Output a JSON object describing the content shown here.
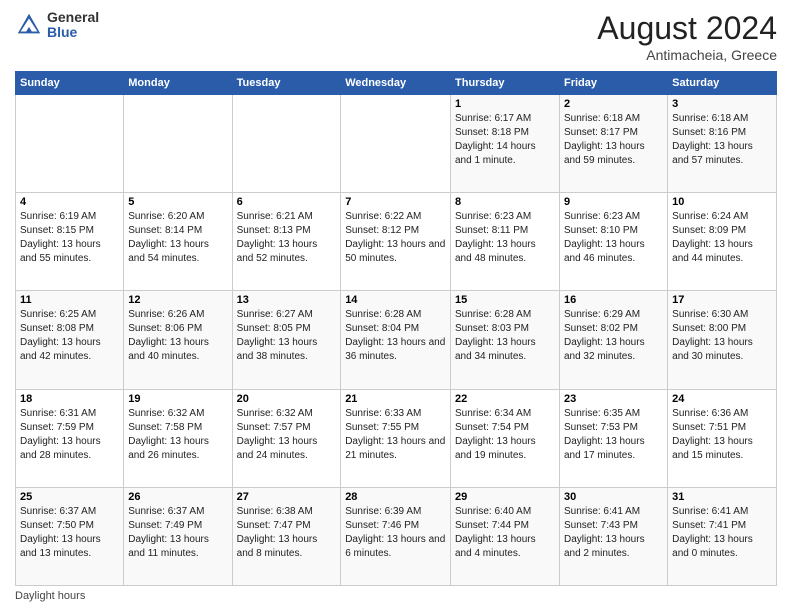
{
  "header": {
    "logo_general": "General",
    "logo_blue": "Blue",
    "month_year": "August 2024",
    "location": "Antimacheia, Greece"
  },
  "calendar": {
    "days_of_week": [
      "Sunday",
      "Monday",
      "Tuesday",
      "Wednesday",
      "Thursday",
      "Friday",
      "Saturday"
    ],
    "weeks": [
      [
        {
          "day": "",
          "info": ""
        },
        {
          "day": "",
          "info": ""
        },
        {
          "day": "",
          "info": ""
        },
        {
          "day": "",
          "info": ""
        },
        {
          "day": "1",
          "info": "Sunrise: 6:17 AM\nSunset: 8:18 PM\nDaylight: 14 hours\nand 1 minute."
        },
        {
          "day": "2",
          "info": "Sunrise: 6:18 AM\nSunset: 8:17 PM\nDaylight: 13 hours\nand 59 minutes."
        },
        {
          "day": "3",
          "info": "Sunrise: 6:18 AM\nSunset: 8:16 PM\nDaylight: 13 hours\nand 57 minutes."
        }
      ],
      [
        {
          "day": "4",
          "info": "Sunrise: 6:19 AM\nSunset: 8:15 PM\nDaylight: 13 hours\nand 55 minutes."
        },
        {
          "day": "5",
          "info": "Sunrise: 6:20 AM\nSunset: 8:14 PM\nDaylight: 13 hours\nand 54 minutes."
        },
        {
          "day": "6",
          "info": "Sunrise: 6:21 AM\nSunset: 8:13 PM\nDaylight: 13 hours\nand 52 minutes."
        },
        {
          "day": "7",
          "info": "Sunrise: 6:22 AM\nSunset: 8:12 PM\nDaylight: 13 hours\nand 50 minutes."
        },
        {
          "day": "8",
          "info": "Sunrise: 6:23 AM\nSunset: 8:11 PM\nDaylight: 13 hours\nand 48 minutes."
        },
        {
          "day": "9",
          "info": "Sunrise: 6:23 AM\nSunset: 8:10 PM\nDaylight: 13 hours\nand 46 minutes."
        },
        {
          "day": "10",
          "info": "Sunrise: 6:24 AM\nSunset: 8:09 PM\nDaylight: 13 hours\nand 44 minutes."
        }
      ],
      [
        {
          "day": "11",
          "info": "Sunrise: 6:25 AM\nSunset: 8:08 PM\nDaylight: 13 hours\nand 42 minutes."
        },
        {
          "day": "12",
          "info": "Sunrise: 6:26 AM\nSunset: 8:06 PM\nDaylight: 13 hours\nand 40 minutes."
        },
        {
          "day": "13",
          "info": "Sunrise: 6:27 AM\nSunset: 8:05 PM\nDaylight: 13 hours\nand 38 minutes."
        },
        {
          "day": "14",
          "info": "Sunrise: 6:28 AM\nSunset: 8:04 PM\nDaylight: 13 hours\nand 36 minutes."
        },
        {
          "day": "15",
          "info": "Sunrise: 6:28 AM\nSunset: 8:03 PM\nDaylight: 13 hours\nand 34 minutes."
        },
        {
          "day": "16",
          "info": "Sunrise: 6:29 AM\nSunset: 8:02 PM\nDaylight: 13 hours\nand 32 minutes."
        },
        {
          "day": "17",
          "info": "Sunrise: 6:30 AM\nSunset: 8:00 PM\nDaylight: 13 hours\nand 30 minutes."
        }
      ],
      [
        {
          "day": "18",
          "info": "Sunrise: 6:31 AM\nSunset: 7:59 PM\nDaylight: 13 hours\nand 28 minutes."
        },
        {
          "day": "19",
          "info": "Sunrise: 6:32 AM\nSunset: 7:58 PM\nDaylight: 13 hours\nand 26 minutes."
        },
        {
          "day": "20",
          "info": "Sunrise: 6:32 AM\nSunset: 7:57 PM\nDaylight: 13 hours\nand 24 minutes."
        },
        {
          "day": "21",
          "info": "Sunrise: 6:33 AM\nSunset: 7:55 PM\nDaylight: 13 hours\nand 21 minutes."
        },
        {
          "day": "22",
          "info": "Sunrise: 6:34 AM\nSunset: 7:54 PM\nDaylight: 13 hours\nand 19 minutes."
        },
        {
          "day": "23",
          "info": "Sunrise: 6:35 AM\nSunset: 7:53 PM\nDaylight: 13 hours\nand 17 minutes."
        },
        {
          "day": "24",
          "info": "Sunrise: 6:36 AM\nSunset: 7:51 PM\nDaylight: 13 hours\nand 15 minutes."
        }
      ],
      [
        {
          "day": "25",
          "info": "Sunrise: 6:37 AM\nSunset: 7:50 PM\nDaylight: 13 hours\nand 13 minutes."
        },
        {
          "day": "26",
          "info": "Sunrise: 6:37 AM\nSunset: 7:49 PM\nDaylight: 13 hours\nand 11 minutes."
        },
        {
          "day": "27",
          "info": "Sunrise: 6:38 AM\nSunset: 7:47 PM\nDaylight: 13 hours\nand 8 minutes."
        },
        {
          "day": "28",
          "info": "Sunrise: 6:39 AM\nSunset: 7:46 PM\nDaylight: 13 hours\nand 6 minutes."
        },
        {
          "day": "29",
          "info": "Sunrise: 6:40 AM\nSunset: 7:44 PM\nDaylight: 13 hours\nand 4 minutes."
        },
        {
          "day": "30",
          "info": "Sunrise: 6:41 AM\nSunset: 7:43 PM\nDaylight: 13 hours\nand 2 minutes."
        },
        {
          "day": "31",
          "info": "Sunrise: 6:41 AM\nSunset: 7:41 PM\nDaylight: 13 hours\nand 0 minutes."
        }
      ]
    ]
  },
  "footer": {
    "text": "Daylight hours"
  }
}
